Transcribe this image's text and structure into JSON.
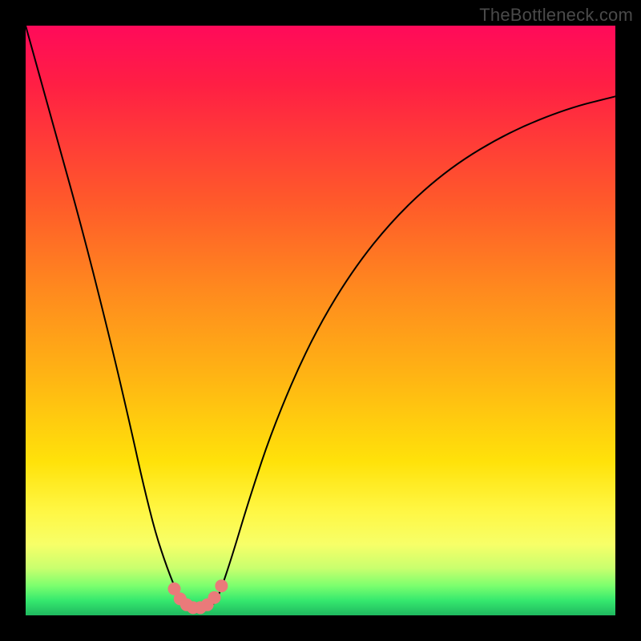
{
  "watermark": "TheBottleneck.com",
  "chart_data": {
    "type": "line",
    "title": "",
    "xlabel": "",
    "ylabel": "",
    "xlim": [
      0,
      100
    ],
    "ylim": [
      0,
      100
    ],
    "series": [
      {
        "name": "bottleneck-curve",
        "x": [
          0,
          5,
          10,
          15,
          18,
          20,
          22,
          24,
          26,
          27,
          28,
          29,
          30,
          31,
          32,
          33,
          35,
          38,
          42,
          48,
          55,
          63,
          72,
          82,
          92,
          100
        ],
        "values": [
          100,
          82,
          64,
          44,
          31,
          22,
          14,
          8,
          3,
          1.5,
          1,
          1,
          1,
          1.2,
          2,
          4,
          10,
          20,
          32,
          46,
          58,
          68,
          76,
          82,
          86,
          88
        ]
      }
    ],
    "markers": {
      "name": "trough-dots",
      "color": "#ea7a7a",
      "points": [
        {
          "x": 25.2,
          "y": 4.5
        },
        {
          "x": 26.2,
          "y": 2.8
        },
        {
          "x": 27.3,
          "y": 1.8
        },
        {
          "x": 28.4,
          "y": 1.3
        },
        {
          "x": 29.6,
          "y": 1.3
        },
        {
          "x": 30.8,
          "y": 1.8
        },
        {
          "x": 32.0,
          "y": 3.0
        },
        {
          "x": 33.2,
          "y": 5.0
        }
      ]
    },
    "gradient_stops": [
      {
        "pos": 0,
        "color": "#ff0a5a"
      },
      {
        "pos": 0.1,
        "color": "#ff1f44"
      },
      {
        "pos": 0.3,
        "color": "#ff5a2a"
      },
      {
        "pos": 0.45,
        "color": "#ff8a1e"
      },
      {
        "pos": 0.6,
        "color": "#ffb613"
      },
      {
        "pos": 0.74,
        "color": "#ffe20a"
      },
      {
        "pos": 0.82,
        "color": "#fff642"
      },
      {
        "pos": 0.88,
        "color": "#f7ff68"
      },
      {
        "pos": 0.92,
        "color": "#c9ff6e"
      },
      {
        "pos": 0.95,
        "color": "#7bff6e"
      },
      {
        "pos": 0.975,
        "color": "#35e86e"
      },
      {
        "pos": 1.0,
        "color": "#1fb85f"
      }
    ]
  }
}
